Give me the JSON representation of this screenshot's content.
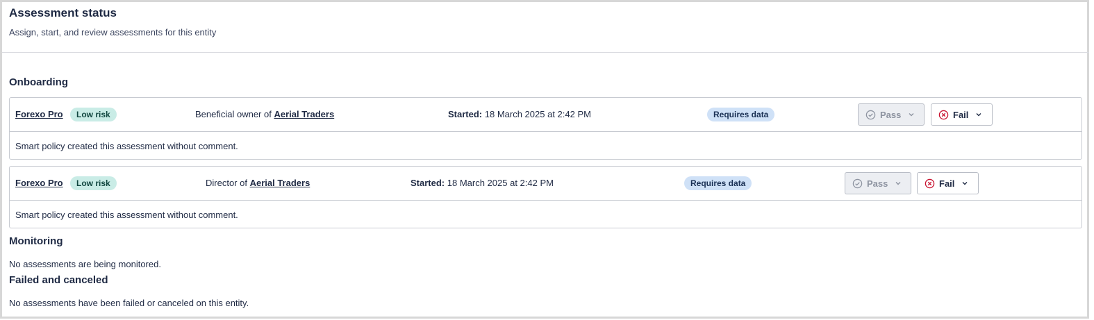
{
  "header": {
    "title": "Assessment status",
    "subtitle": "Assign, start, and review assessments for this entity"
  },
  "sections": {
    "onboarding": {
      "title": "Onboarding",
      "assessments": [
        {
          "name": "Forexo Pro",
          "risk": "Low risk",
          "relation_prefix": "Beneficial owner of",
          "relation_entity": "Aerial Traders",
          "started_label": "Started:",
          "started_value": "18 March 2025 at 2:42 PM",
          "status": "Requires data",
          "pass_label": "Pass",
          "fail_label": "Fail",
          "comment": "Smart policy created this assessment without comment."
        },
        {
          "name": "Forexo Pro",
          "risk": "Low risk",
          "relation_prefix": "Director of",
          "relation_entity": "Aerial Traders",
          "started_label": "Started:",
          "started_value": "18 March 2025 at 2:42 PM",
          "status": "Requires data",
          "pass_label": "Pass",
          "fail_label": "Fail",
          "comment": "Smart policy created this assessment without comment."
        }
      ]
    },
    "monitoring": {
      "title": "Monitoring",
      "empty": "No assessments are being monitored."
    },
    "failed": {
      "title": "Failed and canceled",
      "empty": "No assessments have been failed or canceled on this entity."
    }
  },
  "colors": {
    "risk_badge": "#c9ece6",
    "status_badge": "#cfe1f7",
    "fail_icon": "#c8102e"
  },
  "icons": {
    "pass": "check-circle-icon",
    "fail": "x-circle-icon",
    "dropdown": "chevron-down-icon"
  }
}
